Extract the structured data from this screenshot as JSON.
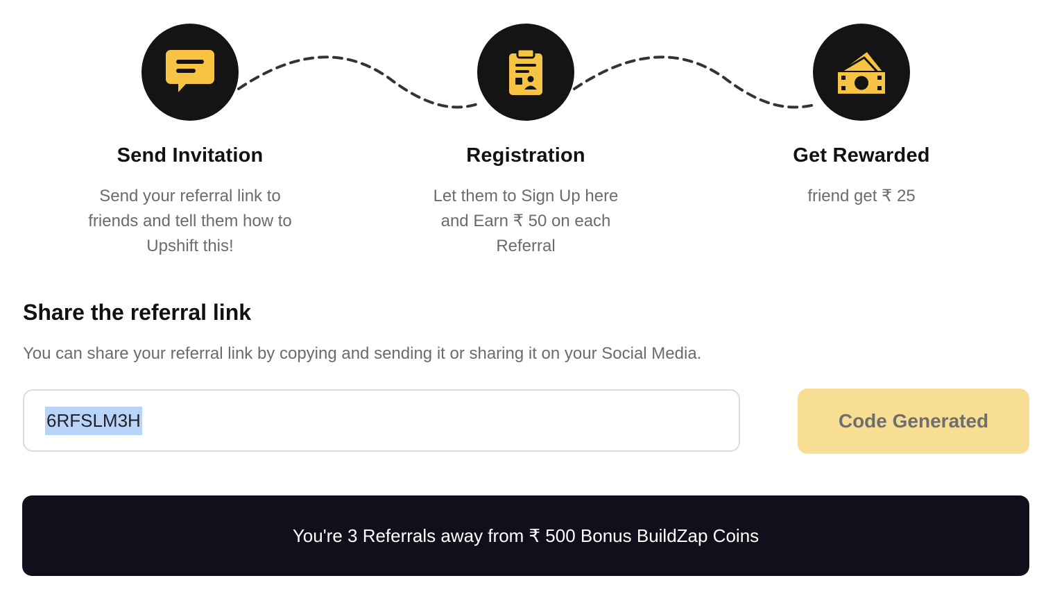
{
  "steps": [
    {
      "title": "Send Invitation",
      "description": "Send your referral link to friends and tell them how to Upshift this!",
      "icon": "chat-bubble-icon"
    },
    {
      "title": "Registration",
      "description": "Let them to Sign Up here and Earn ₹ 50 on each Referral",
      "icon": "clipboard-user-icon"
    },
    {
      "title": "Get Rewarded",
      "description": "friend get ₹ 25",
      "icon": "money-icon"
    }
  ],
  "share": {
    "title": "Share the referral link",
    "description": "You can share your referral link by copying and sending it or sharing it on your Social Media.",
    "code": "6RFSLM3H",
    "button_label": "Code Generated"
  },
  "banner": {
    "text": "You're 3 Referrals away from ₹ 500 Bonus BuildZap Coins"
  },
  "colors": {
    "accent": "#F6C343",
    "circle": "#141414",
    "button_bg": "#F8DE93",
    "banner_bg": "#10101C",
    "selection": "#B9D4FB"
  }
}
